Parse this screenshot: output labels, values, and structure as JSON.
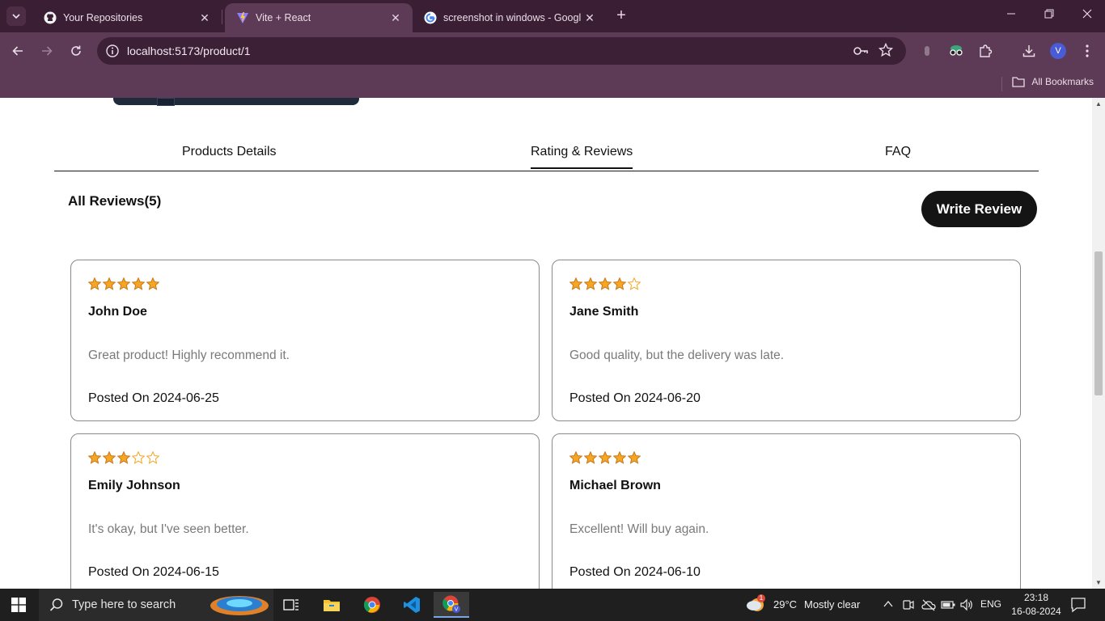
{
  "browser": {
    "tabs": [
      {
        "title": "Your Repositories",
        "icon": "github-icon",
        "active": false
      },
      {
        "title": "Vite + React",
        "icon": "vite-icon",
        "active": true
      },
      {
        "title": "screenshot in windows - Googl",
        "icon": "google-icon",
        "active": false
      }
    ],
    "url": "localhost:5173/product/1",
    "bookmarks_label": "All Bookmarks",
    "profile_initial": "V"
  },
  "page": {
    "tabs": [
      {
        "label": "Products Details",
        "active": false
      },
      {
        "label": "Rating & Reviews",
        "active": true
      },
      {
        "label": "FAQ",
        "active": false
      }
    ],
    "reviews_heading": "All Reviews(5)",
    "write_review_label": "Write Review",
    "reviews": [
      {
        "stars": 5,
        "name": "John Doe",
        "text": "Great product! Highly recommend it.",
        "date": "Posted On 2024-06-25"
      },
      {
        "stars": 4,
        "name": "Jane Smith",
        "text": "Good quality, but the delivery was late.",
        "date": "Posted On 2024-06-20"
      },
      {
        "stars": 3,
        "name": "Emily Johnson",
        "text": "It's okay, but I've seen better.",
        "date": "Posted On 2024-06-15"
      },
      {
        "stars": 5,
        "name": "Michael Brown",
        "text": "Excellent! Will buy again.",
        "date": "Posted On 2024-06-10"
      }
    ],
    "star_color": "#f5a623"
  },
  "taskbar": {
    "search_placeholder": "Type here to search",
    "weather_temp": "29°C",
    "weather_desc": "Mostly clear",
    "weather_badge": "1",
    "language": "ENG",
    "time": "23:18",
    "date": "16-08-2024"
  }
}
